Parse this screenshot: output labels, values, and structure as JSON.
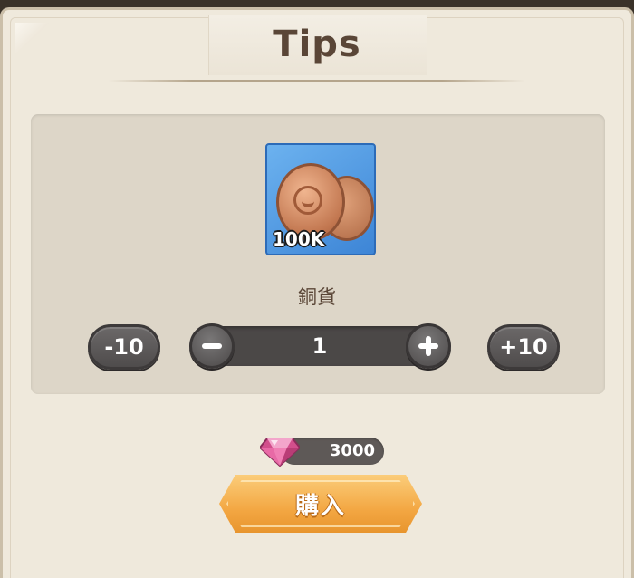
{
  "dialog": {
    "title": "Tips"
  },
  "item": {
    "name": "銅貨",
    "count_label": "100K",
    "icon": "copper-coin-icon",
    "frame_color": "#4a90e2"
  },
  "quantity": {
    "value": "1",
    "minus10_label": "-10",
    "plus10_label": "+10"
  },
  "price": {
    "amount": "3000",
    "currency_icon": "pink-gem-icon"
  },
  "actions": {
    "buy_label": "購入"
  },
  "colors": {
    "panel_bg": "#efe9dc",
    "title_text": "#5a4637",
    "button_dark": "#5a5757",
    "buy_orange": "#f3a743"
  }
}
